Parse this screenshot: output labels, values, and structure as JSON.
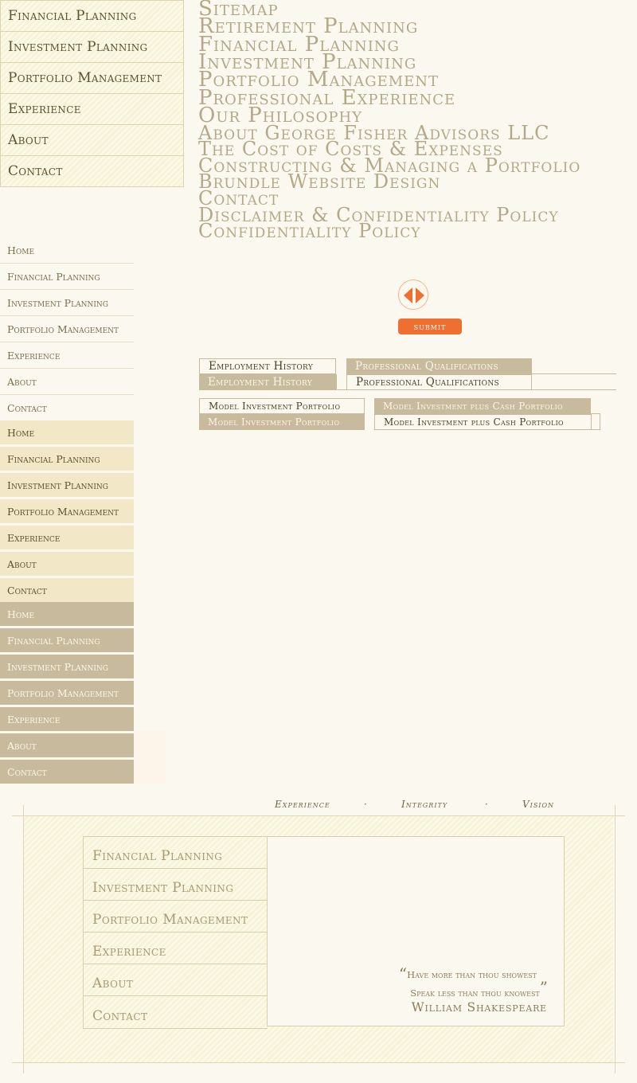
{
  "top_menu": {
    "items": [
      "Financial Planning",
      "Investment Planning",
      "Portfolio Management",
      "Experience",
      "About",
      "Contact"
    ]
  },
  "sitemap": {
    "links": [
      "Sitemap",
      "Retirement Planning",
      "Financial Planning",
      "Investment Planning",
      "Portfolio Management",
      "Professional Experience",
      "Our Philosophy",
      "About George Fisher Advisors LLC",
      "The Cost of Costs & Expenses",
      "Constructing & Managing a Portfolio",
      "Brundle Website Design",
      "Contact",
      "Disclaimer & Confidentiality Policy",
      "Confidentiality Policy"
    ]
  },
  "side_menu": {
    "items": [
      "Home",
      "Financial Planning",
      "Investment Planning",
      "Portfolio Management",
      "Experience",
      "About",
      "Contact"
    ]
  },
  "slider": {
    "prev_icon": "triangle-left-icon",
    "next_icon": "triangle-right-icon",
    "accent": "#ef6f31"
  },
  "submit_label": "submit",
  "tabs_a": {
    "first": "Employment History",
    "second": "Professional Qualifications"
  },
  "tabs_b": {
    "first": "Model Investment Portfolio",
    "second": "Model Investment plus Cash Portfolio"
  },
  "tagline": {
    "items": [
      "Experience",
      "·",
      "Integrity",
      "·",
      "Vision"
    ]
  },
  "footer": {
    "nav": [
      "Financial Planning",
      "Investment Planning",
      "Portfolio Management",
      "Experience",
      "About",
      "Contact"
    ],
    "quote_line1": "Have more than thou showest",
    "quote_line2": "Speak less than thou knowest",
    "quote_open": "“",
    "quote_close": "”",
    "quote_author": "William Shakespeare"
  },
  "colors": {
    "beige": "#c8bb9d",
    "cream": "#fbf9ef",
    "accent": "#ef6f31",
    "text": "#5b5231"
  }
}
